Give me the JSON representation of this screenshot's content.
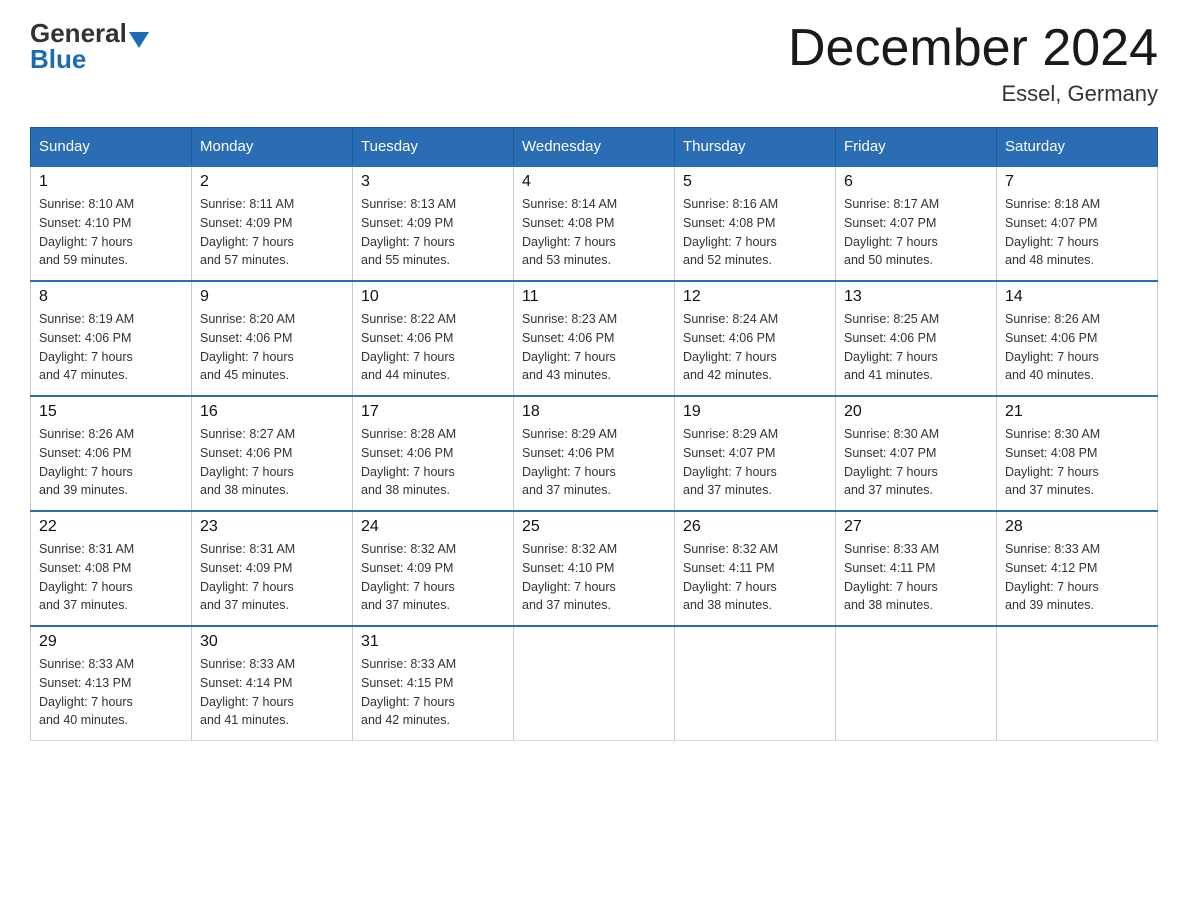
{
  "logo": {
    "general": "General",
    "blue": "Blue"
  },
  "header": {
    "month": "December 2024",
    "location": "Essel, Germany"
  },
  "weekdays": [
    "Sunday",
    "Monday",
    "Tuesday",
    "Wednesday",
    "Thursday",
    "Friday",
    "Saturday"
  ],
  "weeks": [
    [
      {
        "day": "1",
        "sunrise": "8:10 AM",
        "sunset": "4:10 PM",
        "daylight": "7 hours and 59 minutes."
      },
      {
        "day": "2",
        "sunrise": "8:11 AM",
        "sunset": "4:09 PM",
        "daylight": "7 hours and 57 minutes."
      },
      {
        "day": "3",
        "sunrise": "8:13 AM",
        "sunset": "4:09 PM",
        "daylight": "7 hours and 55 minutes."
      },
      {
        "day": "4",
        "sunrise": "8:14 AM",
        "sunset": "4:08 PM",
        "daylight": "7 hours and 53 minutes."
      },
      {
        "day": "5",
        "sunrise": "8:16 AM",
        "sunset": "4:08 PM",
        "daylight": "7 hours and 52 minutes."
      },
      {
        "day": "6",
        "sunrise": "8:17 AM",
        "sunset": "4:07 PM",
        "daylight": "7 hours and 50 minutes."
      },
      {
        "day": "7",
        "sunrise": "8:18 AM",
        "sunset": "4:07 PM",
        "daylight": "7 hours and 48 minutes."
      }
    ],
    [
      {
        "day": "8",
        "sunrise": "8:19 AM",
        "sunset": "4:06 PM",
        "daylight": "7 hours and 47 minutes."
      },
      {
        "day": "9",
        "sunrise": "8:20 AM",
        "sunset": "4:06 PM",
        "daylight": "7 hours and 45 minutes."
      },
      {
        "day": "10",
        "sunrise": "8:22 AM",
        "sunset": "4:06 PM",
        "daylight": "7 hours and 44 minutes."
      },
      {
        "day": "11",
        "sunrise": "8:23 AM",
        "sunset": "4:06 PM",
        "daylight": "7 hours and 43 minutes."
      },
      {
        "day": "12",
        "sunrise": "8:24 AM",
        "sunset": "4:06 PM",
        "daylight": "7 hours and 42 minutes."
      },
      {
        "day": "13",
        "sunrise": "8:25 AM",
        "sunset": "4:06 PM",
        "daylight": "7 hours and 41 minutes."
      },
      {
        "day": "14",
        "sunrise": "8:26 AM",
        "sunset": "4:06 PM",
        "daylight": "7 hours and 40 minutes."
      }
    ],
    [
      {
        "day": "15",
        "sunrise": "8:26 AM",
        "sunset": "4:06 PM",
        "daylight": "7 hours and 39 minutes."
      },
      {
        "day": "16",
        "sunrise": "8:27 AM",
        "sunset": "4:06 PM",
        "daylight": "7 hours and 38 minutes."
      },
      {
        "day": "17",
        "sunrise": "8:28 AM",
        "sunset": "4:06 PM",
        "daylight": "7 hours and 38 minutes."
      },
      {
        "day": "18",
        "sunrise": "8:29 AM",
        "sunset": "4:06 PM",
        "daylight": "7 hours and 37 minutes."
      },
      {
        "day": "19",
        "sunrise": "8:29 AM",
        "sunset": "4:07 PM",
        "daylight": "7 hours and 37 minutes."
      },
      {
        "day": "20",
        "sunrise": "8:30 AM",
        "sunset": "4:07 PM",
        "daylight": "7 hours and 37 minutes."
      },
      {
        "day": "21",
        "sunrise": "8:30 AM",
        "sunset": "4:08 PM",
        "daylight": "7 hours and 37 minutes."
      }
    ],
    [
      {
        "day": "22",
        "sunrise": "8:31 AM",
        "sunset": "4:08 PM",
        "daylight": "7 hours and 37 minutes."
      },
      {
        "day": "23",
        "sunrise": "8:31 AM",
        "sunset": "4:09 PM",
        "daylight": "7 hours and 37 minutes."
      },
      {
        "day": "24",
        "sunrise": "8:32 AM",
        "sunset": "4:09 PM",
        "daylight": "7 hours and 37 minutes."
      },
      {
        "day": "25",
        "sunrise": "8:32 AM",
        "sunset": "4:10 PM",
        "daylight": "7 hours and 37 minutes."
      },
      {
        "day": "26",
        "sunrise": "8:32 AM",
        "sunset": "4:11 PM",
        "daylight": "7 hours and 38 minutes."
      },
      {
        "day": "27",
        "sunrise": "8:33 AM",
        "sunset": "4:11 PM",
        "daylight": "7 hours and 38 minutes."
      },
      {
        "day": "28",
        "sunrise": "8:33 AM",
        "sunset": "4:12 PM",
        "daylight": "7 hours and 39 minutes."
      }
    ],
    [
      {
        "day": "29",
        "sunrise": "8:33 AM",
        "sunset": "4:13 PM",
        "daylight": "7 hours and 40 minutes."
      },
      {
        "day": "30",
        "sunrise": "8:33 AM",
        "sunset": "4:14 PM",
        "daylight": "7 hours and 41 minutes."
      },
      {
        "day": "31",
        "sunrise": "8:33 AM",
        "sunset": "4:15 PM",
        "daylight": "7 hours and 42 minutes."
      },
      null,
      null,
      null,
      null
    ]
  ],
  "labels": {
    "sunrise": "Sunrise:",
    "sunset": "Sunset:",
    "daylight": "Daylight:"
  }
}
